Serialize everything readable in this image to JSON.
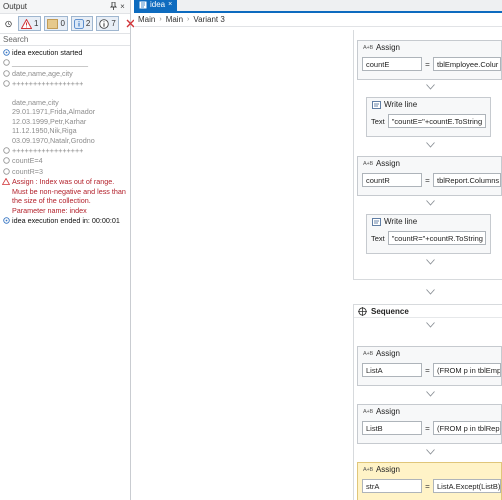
{
  "output_panel": {
    "title": "Output",
    "pin_glyph": "↕",
    "close_glyph": "×",
    "filters": [
      {
        "name": "errors",
        "count": "1",
        "color": "#d13438"
      },
      {
        "name": "warnings",
        "count": "0",
        "color": "#c8a25a"
      },
      {
        "name": "info",
        "count": "2",
        "color": "#3b78c4"
      },
      {
        "name": "trace",
        "count": "7",
        "color": "#555555"
      }
    ],
    "search_placeholder": "Search",
    "log": [
      {
        "level": "info",
        "text": "idea execution started"
      },
      {
        "level": "trace",
        "text": "___________________"
      },
      {
        "level": "trace",
        "text": "date,name,age,city"
      },
      {
        "level": "trace",
        "text": "+++++++++++++++++\n\ndate,name,city\n29.01.1971,Frida,Almador\n12.03.1999,Petr,Karhar\n11.12.1950,Nik,Riga\n03.09.1970,Natalr,Grodno"
      },
      {
        "level": "trace",
        "text": "+++++++++++++++++"
      },
      {
        "level": "trace",
        "text": "countE=4"
      },
      {
        "level": "trace",
        "text": "countR=3"
      },
      {
        "level": "error",
        "text": "Assign : Index was out of range.\nMust be non-negative and less than\nthe size of the collection.\nParameter name: index"
      },
      {
        "level": "info",
        "text": "idea execution ended in: 00:00:01"
      }
    ]
  },
  "designer": {
    "tab_label": "idea",
    "tab_close": "×",
    "breadcrumb": [
      "Main",
      "Main",
      "Variant 3"
    ],
    "sequence_label": "Sequence",
    "top_activities": [
      {
        "type": "Assign",
        "to": "countE",
        "value": "tblEmployee.Colur"
      },
      {
        "type": "Write line",
        "text_label": "Text",
        "text": "\"countE=\"+countE.ToString"
      },
      {
        "type": "Assign",
        "to": "countR",
        "value": "tblReport.Columns"
      },
      {
        "type": "Write line",
        "text_label": "Text",
        "text": "\"countR=\"+countR.ToString"
      }
    ],
    "seq_activities": [
      {
        "type": "Assign",
        "to": "ListA",
        "value": "(FROM p in tblEmp"
      },
      {
        "type": "Assign",
        "to": "ListB",
        "value": "(FROM p in tblRep"
      },
      {
        "type": "Assign",
        "to": "strA",
        "value": "ListA.Except(ListB)",
        "highlighted": true
      }
    ],
    "assign_badge": "A+B",
    "eq_sign": "="
  },
  "colors": {
    "accent": "#0d6bbf",
    "error_text": "#b3212b",
    "highlight": "#fff3c7"
  }
}
